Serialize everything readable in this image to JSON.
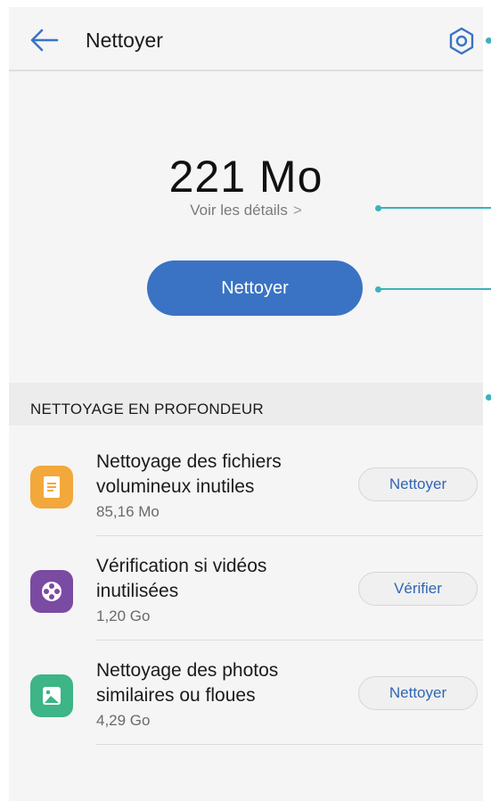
{
  "header": {
    "title": "Nettoyer",
    "back_icon": "arrow-left-icon",
    "settings_icon": "gear-icon"
  },
  "summary": {
    "size": "221  Mo",
    "details_link": "Voir les détails",
    "details_chevron": ">",
    "clean_button": "Nettoyer"
  },
  "deep_clean": {
    "section_title": "NETTOYAGE EN PROFONDEUR",
    "items": [
      {
        "title": "Nettoyage des fichiers volumineux inutiles",
        "size": "85,16  Mo",
        "action": "Nettoyer",
        "icon": "document-icon",
        "icon_color": "#f2a83b"
      },
      {
        "title": "Vérification si vidéos inutilisées",
        "size": "1,20  Go",
        "action": "Vérifier",
        "icon": "film-reel-icon",
        "icon_color": "#7b4aa3"
      },
      {
        "title": "Nettoyage des photos similaires ou floues",
        "size": "4,29  Go",
        "action": "Nettoyer",
        "icon": "photo-icon",
        "icon_color": "#3db586"
      }
    ]
  },
  "colors": {
    "accent": "#3a73c4",
    "callout": "#3bb2bd"
  }
}
